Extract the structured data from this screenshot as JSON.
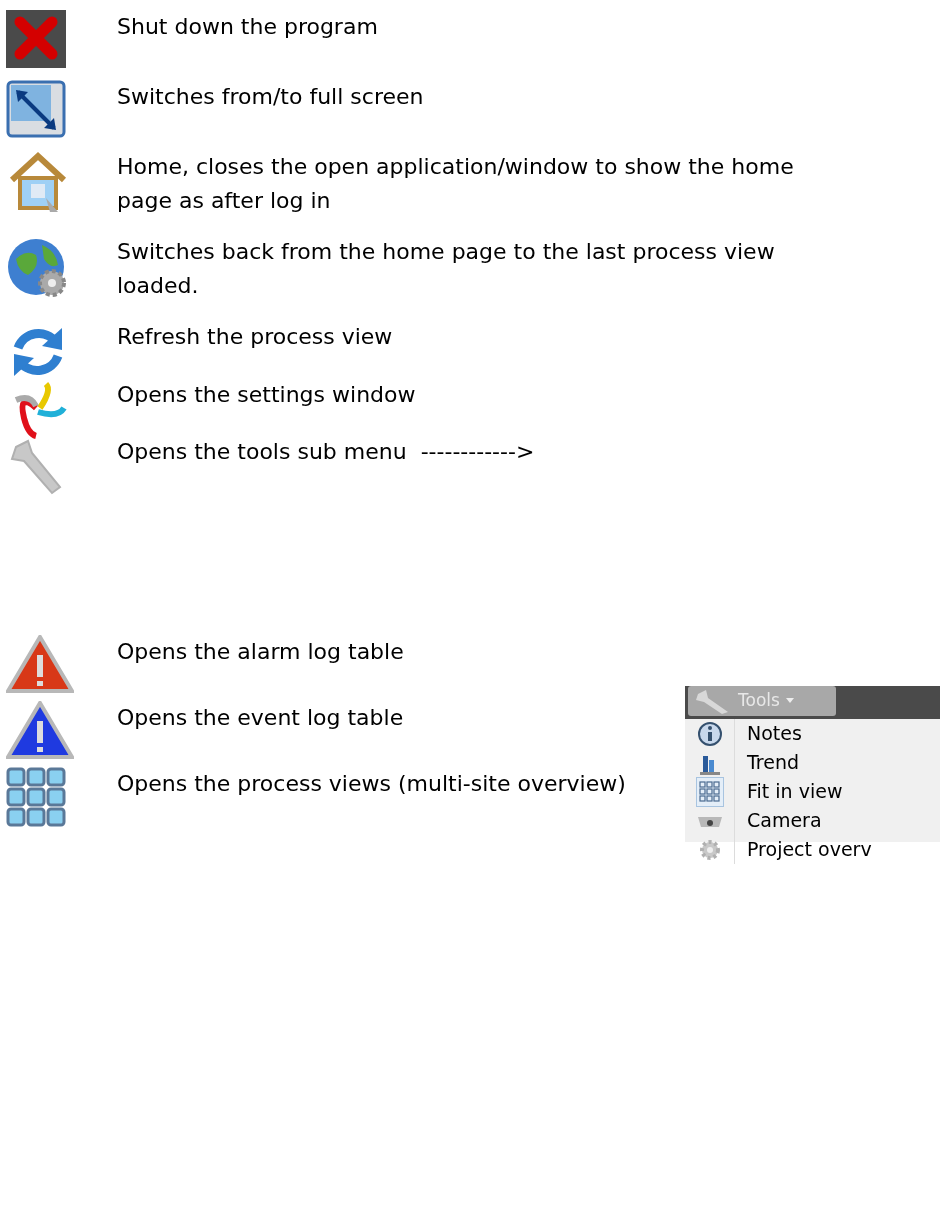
{
  "items": [
    {
      "kind": "close",
      "description": "Shut down the program"
    },
    {
      "kind": "fullscreen",
      "description": "Switches from/to full screen"
    },
    {
      "kind": "home",
      "description": "Home, closes the open application/window to show the home page as after log in"
    },
    {
      "kind": "globe",
      "description": "Switches back from the home page to the last process view loaded."
    },
    {
      "kind": "refresh",
      "description": "Refresh the process view"
    },
    {
      "kind": "settings",
      "description": "Opens the settings window"
    },
    {
      "kind": "tools",
      "description": "Opens the tools sub menu  ------------>"
    },
    {
      "kind": "alarm",
      "description": "Opens the alarm log table"
    },
    {
      "kind": "event",
      "description": "Opens the event log table"
    },
    {
      "kind": "views",
      "description": "Opens the process views (multi-site overview)"
    }
  ],
  "tools_menu": {
    "title": "Tools",
    "items": [
      {
        "kind": "info",
        "label": "Notes"
      },
      {
        "kind": "trend",
        "label": "Trend"
      },
      {
        "kind": "grid",
        "label": "Fit in view"
      },
      {
        "kind": "camera",
        "label": "Camera"
      },
      {
        "kind": "gear",
        "label": "Project overv"
      }
    ]
  }
}
